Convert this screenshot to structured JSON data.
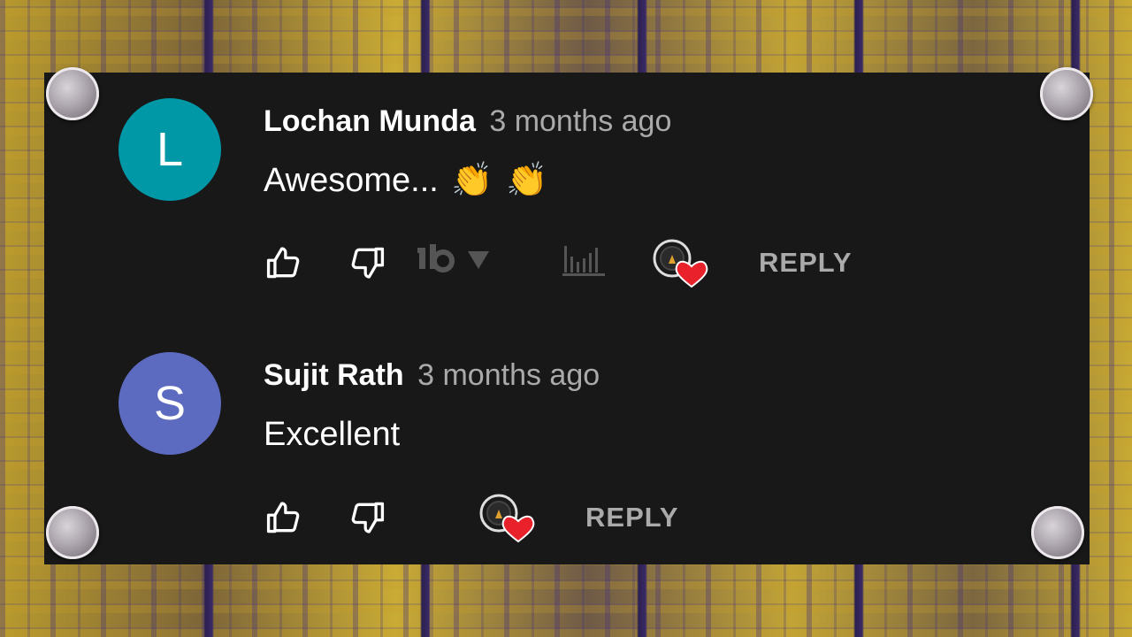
{
  "comments": [
    {
      "avatar_letter": "L",
      "avatar_color": "#0097a7",
      "author": "Lochan Munda",
      "time": "3 months ago",
      "text": "Awesome...",
      "emojis": [
        "👏",
        "👏"
      ],
      "reply_label": "REPLY",
      "has_extension_icons": true
    },
    {
      "avatar_letter": "S",
      "avatar_color": "#5c6bc0",
      "author": "Sujit Rath",
      "time": "3 months ago",
      "text": "Excellent",
      "emojis": [],
      "reply_label": "REPLY",
      "has_extension_icons": false
    }
  ],
  "colors": {
    "panel": "#181818",
    "heart": "#e8212b",
    "muted": "#aaaaaa"
  }
}
